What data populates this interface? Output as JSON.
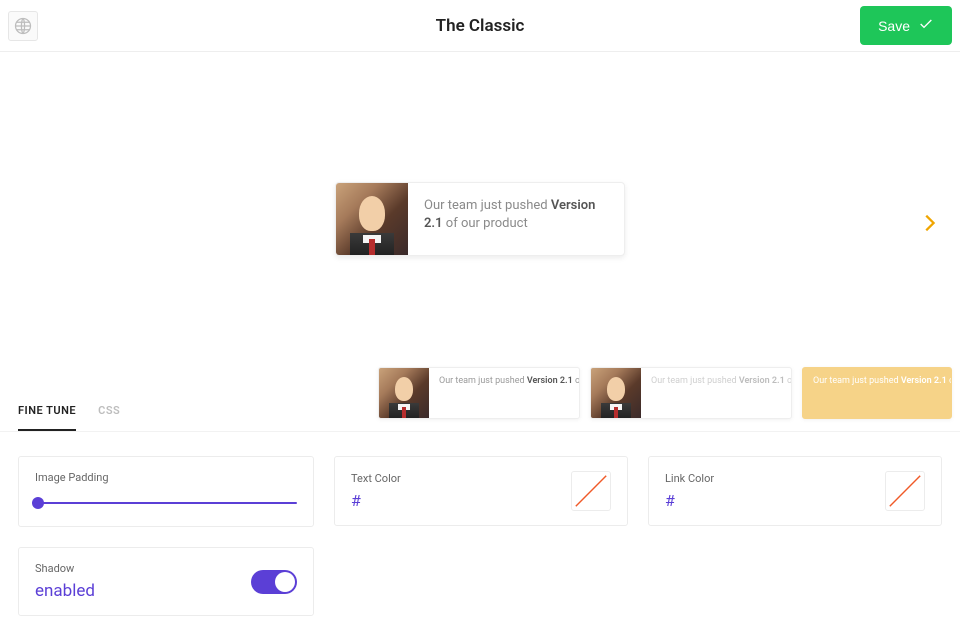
{
  "header": {
    "title": "The Classic",
    "save_label": "Save"
  },
  "preview": {
    "message_prefix": "Our team just pushed ",
    "message_bold": "Version 2.1",
    "message_suffix": " of our product"
  },
  "thumbs": [
    {
      "prefix": "Our team just pushed ",
      "bold": "Version 2.1",
      "suffix": " of our product",
      "variant": "normal"
    },
    {
      "prefix": "Our team just pushed ",
      "bold": "Version 2.1",
      "suffix": " of our product",
      "variant": "faded"
    },
    {
      "prefix": "Our team just pushed ",
      "bold": "Version 2.1",
      "suffix": " of our product",
      "variant": "highlight"
    }
  ],
  "tabs": {
    "finetune": "FINE TUNE",
    "css": "CSS"
  },
  "controls": {
    "image_padding": {
      "label": "Image Padding",
      "value": 0
    },
    "shadow": {
      "label": "Shadow",
      "value": "enabled",
      "on": true
    },
    "text_color": {
      "label": "Text Color",
      "hash": "#",
      "value": ""
    },
    "link_color": {
      "label": "Link Color",
      "hash": "#",
      "value": ""
    }
  }
}
